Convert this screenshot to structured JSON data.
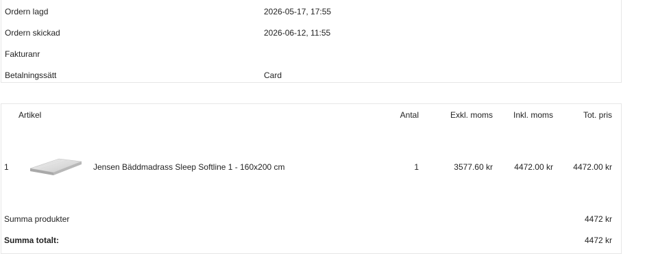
{
  "order_info": [
    {
      "label": "Ordern lagd",
      "value": "2026-05-17, 17:55"
    },
    {
      "label": "Ordern skickad",
      "value": "2026-06-12, 11:55"
    },
    {
      "label": "Fakturanr",
      "value": ""
    },
    {
      "label": "Betalningssätt",
      "value": "Card"
    }
  ],
  "table": {
    "headers": {
      "article": "Artikel",
      "qty": "Antal",
      "ex_vat": "Exkl. moms",
      "inc_vat": "Inkl. moms",
      "total": "Tot. pris"
    },
    "rows": [
      {
        "index": "1",
        "product_image": "mattress-topper-image",
        "name": "Jensen Bäddmadrass Sleep Softline 1 - 160x200 cm",
        "qty": "1",
        "ex_vat": "3577.60 kr",
        "inc_vat": "4472.00 kr",
        "total": "4472.00 kr"
      }
    ]
  },
  "summary": {
    "products_label": "Summa produkter",
    "products_value": "4472 kr",
    "total_label": "Summa totalt:",
    "total_value": "4472 kr"
  }
}
